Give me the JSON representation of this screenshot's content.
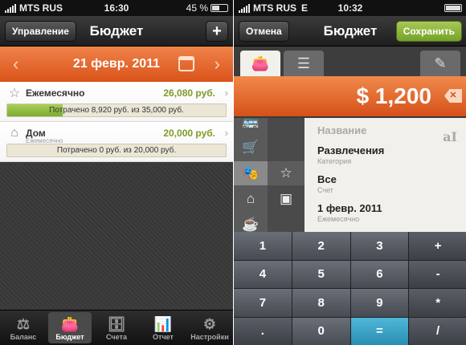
{
  "left": {
    "status": {
      "carrier": "MTS RUS",
      "time": "16:30",
      "battery": "45 %"
    },
    "nav": {
      "title": "Бюджет",
      "manage_label": "Управление",
      "add_label": "+"
    },
    "date_bar": {
      "date": "21 февр. 2011",
      "prev": "‹",
      "next": "›"
    },
    "budgets": [
      {
        "icon": "star-icon",
        "glyph": "☆",
        "name": "Ежемесячно",
        "subtitle": "",
        "amount": "26,080 руб.",
        "progress_text": "Потрачено 8,920 руб. из 35,000 руб.",
        "spent_fraction": 0.255
      },
      {
        "icon": "house-icon",
        "glyph": "⌂",
        "name": "Дом",
        "subtitle": "Ежемесячно",
        "amount": "20,000 руб.",
        "progress_text": "Потрачено 0 руб. из 20,000 руб.",
        "spent_fraction": 0.0
      }
    ],
    "tabs": [
      {
        "id": "balance",
        "label": "Баланс",
        "glyph": "⚖",
        "icon": "scales-icon",
        "active": false
      },
      {
        "id": "budget",
        "label": "Бюджет",
        "glyph": "👛",
        "icon": "wallet-icon",
        "active": true
      },
      {
        "id": "accounts",
        "label": "Счета",
        "glyph": "🗄",
        "icon": "drawer-icon",
        "active": false
      },
      {
        "id": "report",
        "label": "Отчет",
        "glyph": "📊",
        "icon": "bar-chart-icon",
        "active": false
      },
      {
        "id": "settings",
        "label": "Настройки",
        "glyph": "⚙",
        "icon": "gear-icon",
        "active": false
      }
    ]
  },
  "right": {
    "status": {
      "carrier": "MTS RUS",
      "network": "E",
      "time": "10:32"
    },
    "nav": {
      "title": "Бюджет",
      "cancel_label": "Отмена",
      "save_label": "Сохранить"
    },
    "amount": "$ 1,200",
    "delete_glyph": "✕",
    "form": {
      "name_placeholder": "Название",
      "category_value": "Развлечения",
      "category_hint": "Категория",
      "account_value": "Все",
      "account_hint": "Счет",
      "date_value": "1 февр. 2011",
      "period_hint": "Ежемесячно"
    },
    "keypad": [
      "1",
      "2",
      "3",
      "+",
      "4",
      "5",
      "6",
      "-",
      "7",
      "8",
      "9",
      "*",
      ".",
      "0",
      "=",
      "/"
    ]
  }
}
